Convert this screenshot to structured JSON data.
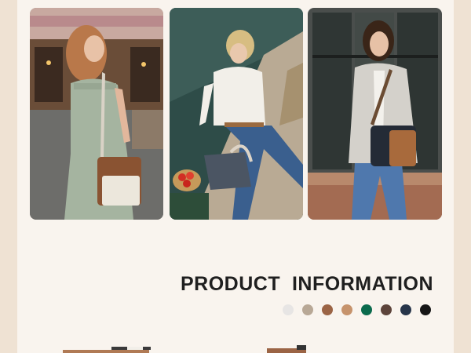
{
  "product_info": {
    "title": "PRODUCT  INFORMATION"
  },
  "color_options": [
    {
      "name": "light-grey",
      "hex": "#e7e5e4"
    },
    {
      "name": "taupe",
      "hex": "#b8a896"
    },
    {
      "name": "brown",
      "hex": "#9b6445"
    },
    {
      "name": "camel",
      "hex": "#c6936c"
    },
    {
      "name": "green",
      "hex": "#0b6b4d"
    },
    {
      "name": "dark-brown",
      "hex": "#5d443b"
    },
    {
      "name": "navy",
      "hex": "#27354a"
    },
    {
      "name": "black",
      "hex": "#161616"
    }
  ],
  "gallery": [
    {
      "icon": "woman-with-crossbody-bag-cafe-photo"
    },
    {
      "icon": "woman-sitting-riverside-photo"
    },
    {
      "icon": "woman-walking-plaid-blazer-photo"
    }
  ]
}
